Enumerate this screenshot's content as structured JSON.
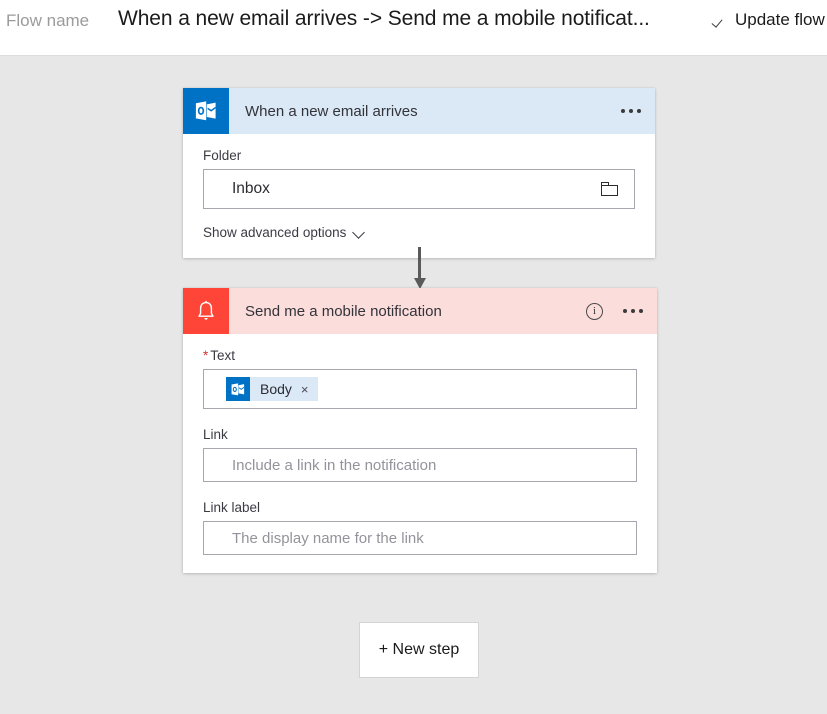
{
  "topbar": {
    "flow_name_label": "Flow name",
    "flow_title": "When a new email arrives -> Send me a mobile notificat...",
    "update_flow_label": "Update flow",
    "check_icon": "check-icon"
  },
  "colors": {
    "page_background": "#e7e7e7",
    "outlook_blue": "#0072c6",
    "trigger_header_blue": "#dbe9f7",
    "notification_red": "#ff4438",
    "action_header_pink": "#fbdddc",
    "required_star": "#d13438"
  },
  "cards": {
    "trigger": {
      "title": "When a new email arrives",
      "icon": "outlook-icon",
      "menu_icon": "ellipsis-icon",
      "folder": {
        "label": "Folder",
        "value": "Inbox",
        "picker_icon": "folder-icon"
      },
      "show_advanced_label": "Show advanced options",
      "show_advanced_icon": "chevron-down-icon"
    },
    "action": {
      "title": "Send me a mobile notification",
      "icon": "bell-icon",
      "info_icon": "info-icon",
      "menu_icon": "ellipsis-icon",
      "text_field": {
        "label": "Text",
        "required_marker": "*",
        "token": {
          "label": "Body",
          "icon": "outlook-icon",
          "remove_icon": "close-icon",
          "remove_glyph": "×"
        }
      },
      "link_field": {
        "label": "Link",
        "placeholder": "Include a link in the notification",
        "value": ""
      },
      "link_label_field": {
        "label": "Link label",
        "placeholder": "The display name for the link",
        "value": ""
      }
    }
  },
  "new_step_button": {
    "label": "+ New step"
  }
}
